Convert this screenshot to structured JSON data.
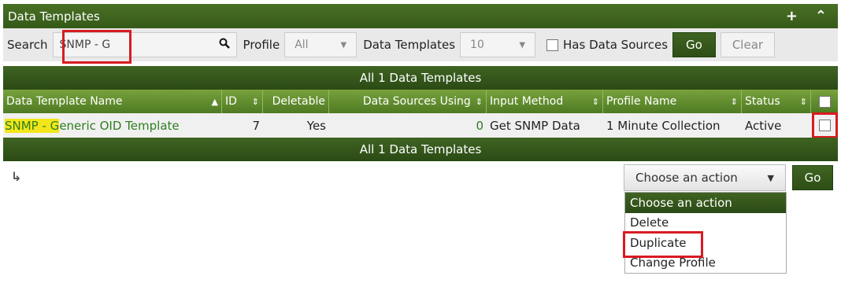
{
  "header": {
    "title": "Data Templates",
    "add_icon": "+",
    "collapse_icon": "⌃"
  },
  "filters": {
    "search_label": "Search",
    "search_value": "SNMP - G",
    "profile_label": "Profile",
    "profile_value": "All",
    "rows_label": "Data Templates",
    "rows_value": "10",
    "has_sources_label": "Has Data Sources",
    "go_label": "Go",
    "clear_label": "Clear"
  },
  "table": {
    "summary_top": "All 1 Data Templates",
    "summary_bottom": "All 1 Data Templates",
    "columns": [
      "Data Template Name",
      "ID",
      "Deletable",
      "Data Sources Using",
      "Input Method",
      "Profile Name",
      "Status"
    ],
    "row": {
      "name_highlight": "SNMP - G",
      "name_rest": "eneric OID Template",
      "id": "7",
      "deletable": "Yes",
      "sources_using": "0",
      "input_method": "Get SNMP Data",
      "profile_name": "1 Minute Collection",
      "status": "Active"
    }
  },
  "actions": {
    "select_value": "Choose an action",
    "go_label": "Go",
    "options": [
      "Choose an action",
      "Delete",
      "Duplicate",
      "Change Profile"
    ]
  },
  "colors": {
    "brand_green": "#3f6422",
    "highlight": "#d81b21",
    "match": "#f2e61a"
  }
}
